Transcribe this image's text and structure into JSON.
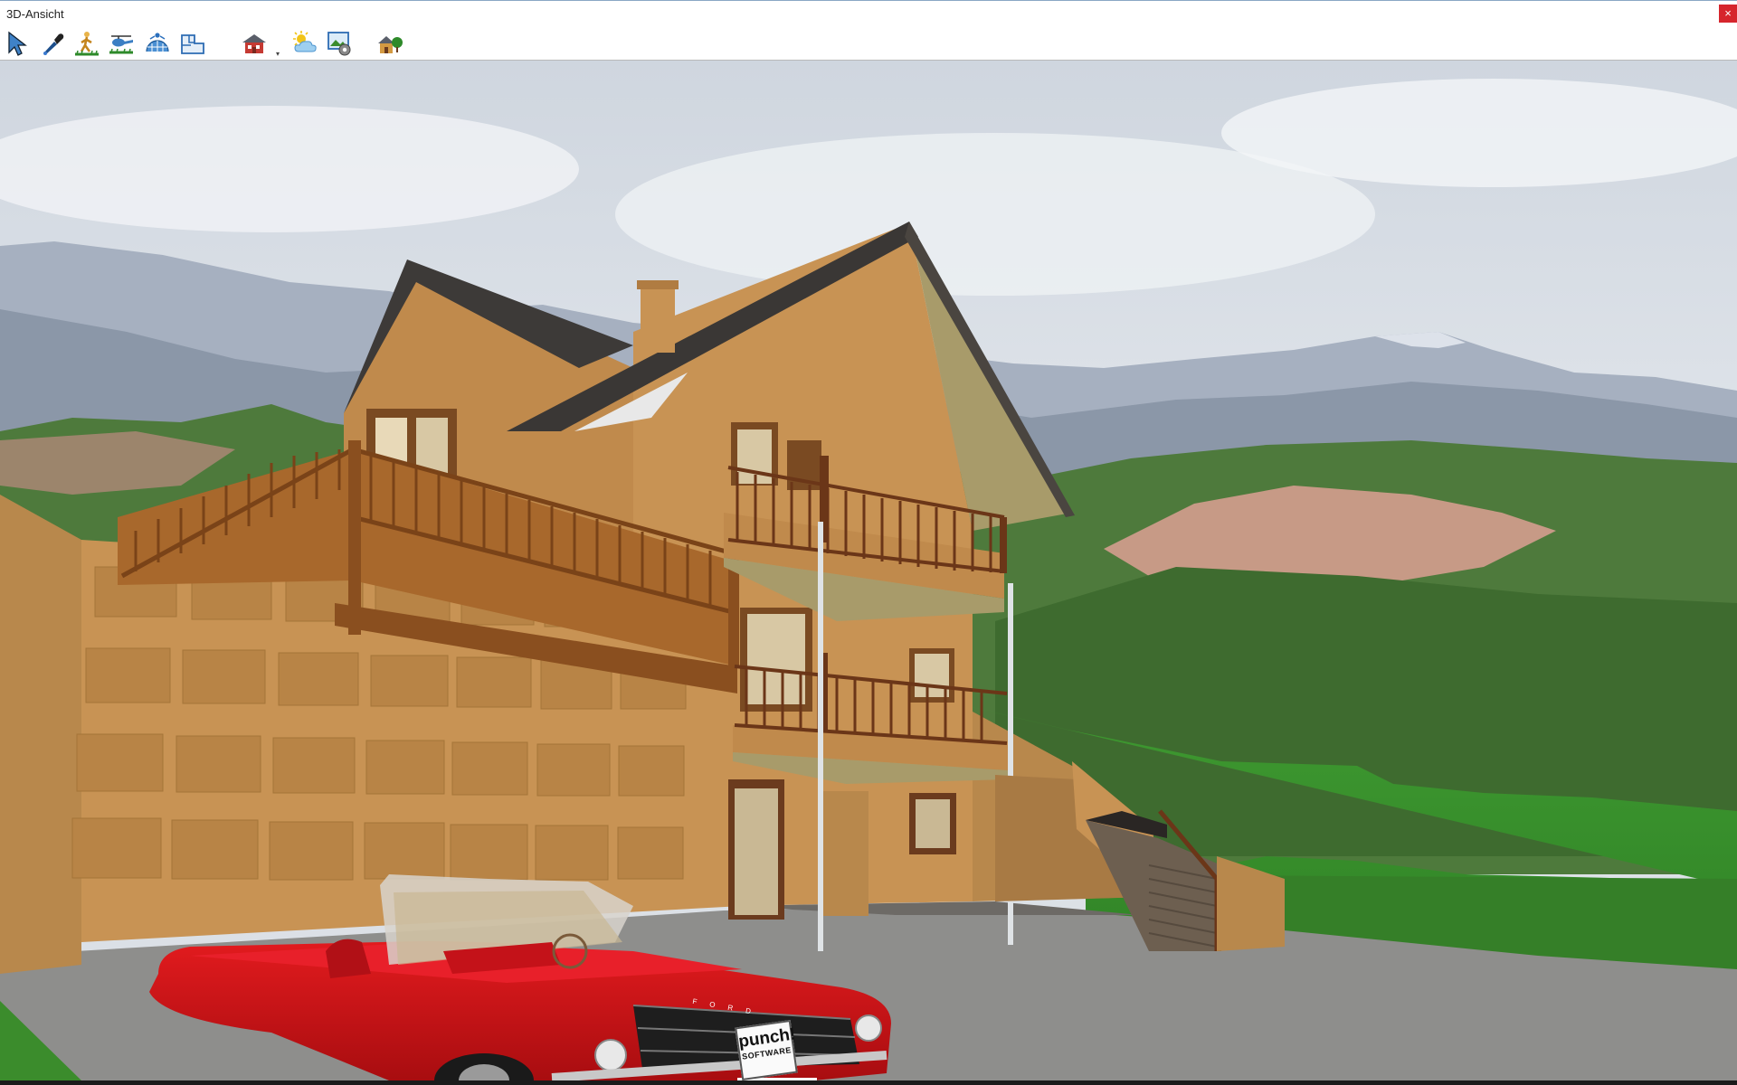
{
  "window": {
    "title": "3D-Ansicht",
    "close_glyph": "×"
  },
  "toolbar": {
    "tools": [
      {
        "icon": "select-arrow-icon"
      },
      {
        "icon": "eyedropper-icon"
      },
      {
        "icon": "walk-person-icon"
      },
      {
        "icon": "helicopter-icon"
      },
      {
        "icon": "orbit-globe-icon"
      },
      {
        "icon": "floor-plan-icon"
      },
      {
        "icon": "house-view-icon"
      },
      {
        "icon": "weather-sun-cloud-icon"
      },
      {
        "icon": "render-settings-icon"
      },
      {
        "icon": "landscape-house-icon"
      }
    ],
    "dropdown_glyph": "▾"
  },
  "scene": {
    "license_plate_line1": "punch!",
    "license_plate_line2": "SOFTWARE",
    "hood_lettering": "F O R D",
    "colors": {
      "sky": "#d6dde6",
      "house_wall": "#c89354",
      "roof": "#3d3a38",
      "car_red": "#d41418",
      "grass": "#3b8c2c",
      "driveway": "#8e8e8c"
    }
  }
}
